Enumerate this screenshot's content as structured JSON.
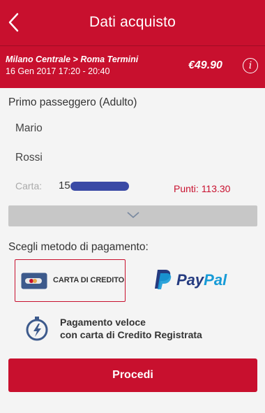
{
  "header": {
    "title": "Dati acquisto"
  },
  "trip": {
    "route": "Milano Centrale > Roma Termini",
    "datetime": "16 Gen 2017 17:20 - 20:40",
    "price": "€49.90",
    "info_glyph": "i"
  },
  "passenger": {
    "title": "Primo passeggero (Adulto)",
    "first_name": "Mario",
    "last_name": "Rossi",
    "card_label": "Carta:",
    "card_number_visible": "15",
    "points": "Punti: 113.30"
  },
  "payment": {
    "title": "Scegli metodo di pagamento:",
    "credit_card_label": "CARTA DI CREDITO",
    "paypal_part1": "Pay",
    "paypal_part2": "Pal",
    "fast_line1": "Pagamento veloce",
    "fast_line2": "con carta di Credito Registrata"
  },
  "actions": {
    "proceed_label": "Procedi"
  },
  "colors": {
    "brand_red": "#c8102e",
    "paypal_dark": "#253b80",
    "paypal_light": "#179bd7"
  },
  "icons": {
    "back": "chevron-left-icon",
    "info": "info-icon",
    "expand": "chevron-down-icon",
    "credit_card": "credit-card-icon",
    "paypal": "paypal-logo",
    "fast_payment": "stopwatch-icon"
  }
}
